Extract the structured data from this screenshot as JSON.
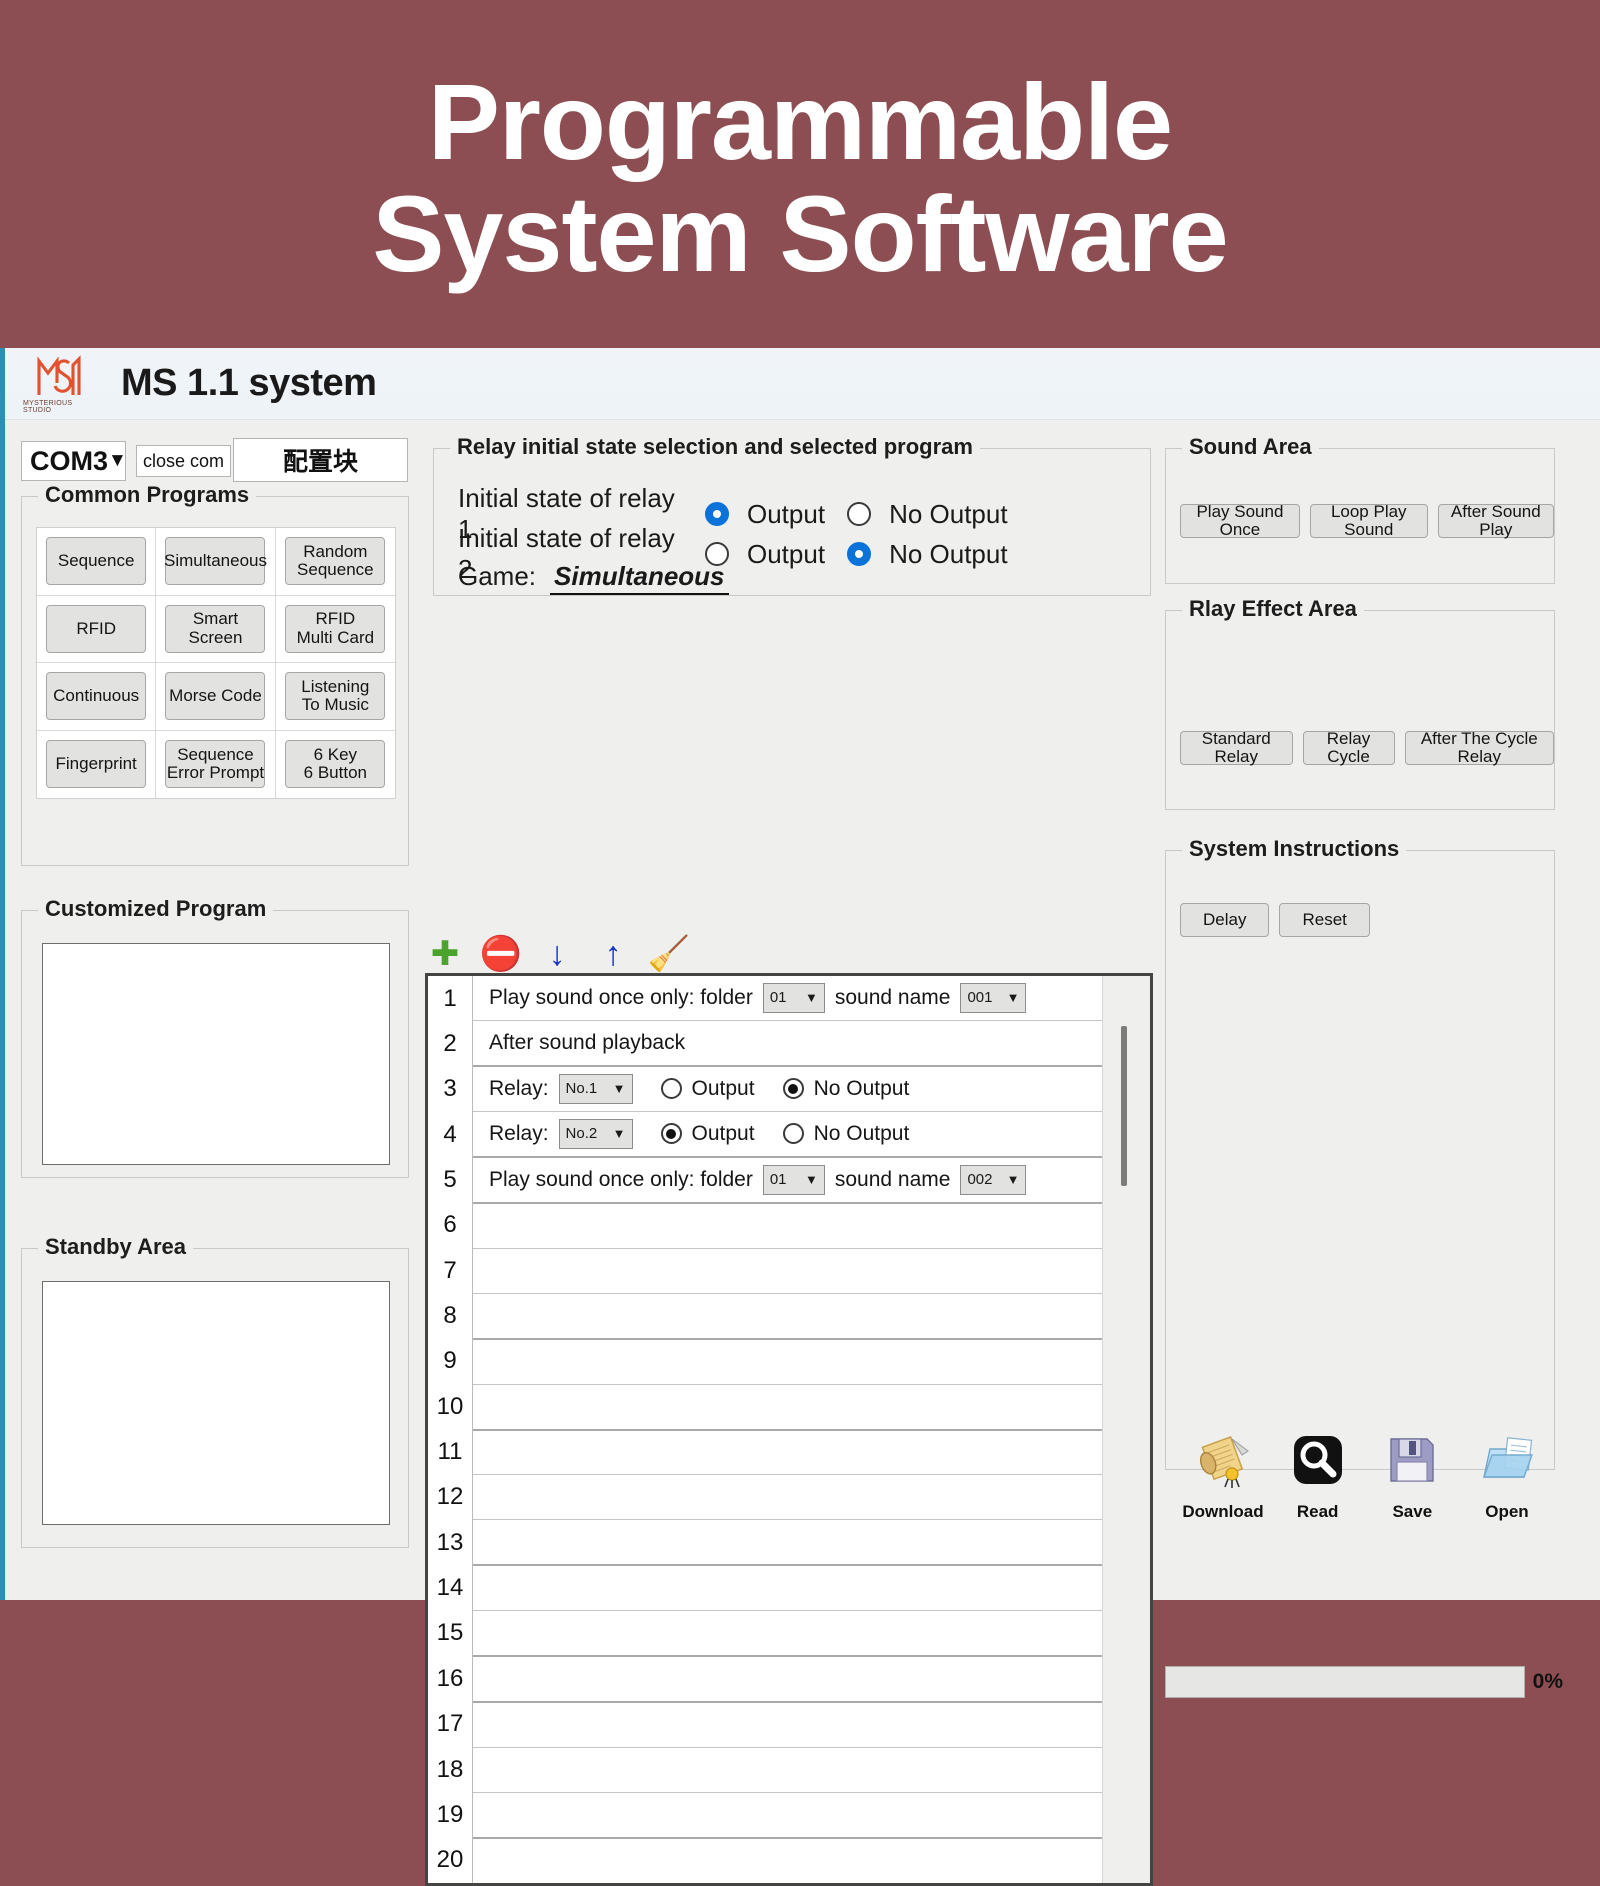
{
  "banner": {
    "line1": "Programmable",
    "line2": "System Software",
    "bg_color": "#8d4e53",
    "text_color": "#ffffff"
  },
  "titlebar": {
    "app_title": "MS 1.1 system",
    "logo_subtitle": "MYSTERIOUS STUDIO",
    "logo_color": "#e2522e"
  },
  "left": {
    "com_port": {
      "value": "COM3",
      "arrow": "▼"
    },
    "close_com_label": "close com",
    "config_block_label": "配置块",
    "common_programs": {
      "legend": "Common Programs",
      "buttons": [
        "Sequence",
        "Simultaneous",
        "Random\nSequence",
        "RFID",
        "Smart\nScreen",
        "RFID\nMulti Card",
        "Continuous",
        "Morse Code",
        "Listening\nTo Music",
        "Fingerprint",
        "Sequence\nError Prompt",
        "6 Key\n6 Button"
      ]
    },
    "customized_program": {
      "legend": "Customized Program",
      "content": ""
    },
    "standby_area": {
      "legend": "Standby Area",
      "content": ""
    }
  },
  "center": {
    "relay_init": {
      "legend": "Relay initial state selection and selected program",
      "relay1": {
        "label": "Initial state of relay 1",
        "output_label": "Output",
        "no_output_label": "No Output",
        "selected": "Output"
      },
      "relay2": {
        "label": "Initial state of relay 2",
        "output_label": "Output",
        "no_output_label": "No Output",
        "selected": "No Output"
      },
      "game_label": "Game:",
      "game_value": "Simultaneous"
    },
    "toolbar": [
      {
        "name": "add-icon",
        "glyph": "✚",
        "color": "#4aa32d"
      },
      {
        "name": "remove-icon",
        "glyph": "⛔",
        "color": "#cc2222"
      },
      {
        "name": "move-down-icon",
        "glyph": "↓",
        "color": "#1634c8"
      },
      {
        "name": "move-up-icon",
        "glyph": "↑",
        "color": "#1634c8"
      },
      {
        "name": "clear-broom-icon",
        "glyph": "🧹",
        "color": "#c9a44c"
      }
    ],
    "row_numbers": [
      "1",
      "2",
      "3",
      "4",
      "5",
      "6",
      "7",
      "8",
      "9",
      "10",
      "11",
      "12",
      "13",
      "14",
      "15",
      "16",
      "17",
      "18",
      "19",
      "20"
    ],
    "rows": [
      {
        "index": 1,
        "type": "play-sound-once",
        "text_before": "Play sound once only: folder",
        "folder_value": "01",
        "text_middle": "sound name",
        "sound_value": "001"
      },
      {
        "index": 2,
        "type": "text",
        "text_before": "After sound playback"
      },
      {
        "index": 3,
        "type": "relay",
        "text_before": "Relay:",
        "relay_value": "No.1",
        "output_label": "Output",
        "no_output_label": "No Output",
        "selected": "No Output"
      },
      {
        "index": 4,
        "type": "relay",
        "text_before": "Relay:",
        "relay_value": "No.2",
        "output_label": "Output",
        "no_output_label": "No Output",
        "selected": "Output"
      },
      {
        "index": 5,
        "type": "play-sound-once",
        "text_before": "Play sound once only: folder",
        "folder_value": "01",
        "text_middle": "sound name",
        "sound_value": "002"
      },
      {
        "index": 6,
        "type": "empty"
      },
      {
        "index": 7,
        "type": "empty"
      },
      {
        "index": 8,
        "type": "empty"
      },
      {
        "index": 9,
        "type": "empty"
      },
      {
        "index": 10,
        "type": "empty"
      },
      {
        "index": 11,
        "type": "empty"
      },
      {
        "index": 12,
        "type": "empty"
      },
      {
        "index": 13,
        "type": "empty"
      },
      {
        "index": 14,
        "type": "empty"
      },
      {
        "index": 15,
        "type": "empty"
      },
      {
        "index": 16,
        "type": "empty"
      },
      {
        "index": 17,
        "type": "empty"
      },
      {
        "index": 18,
        "type": "empty"
      },
      {
        "index": 19,
        "type": "empty"
      },
      {
        "index": 20,
        "type": "empty"
      }
    ]
  },
  "right": {
    "sound_area": {
      "legend": "Sound Area",
      "buttons": [
        "Play Sound Once",
        "Loop Play Sound",
        "After Sound Play"
      ]
    },
    "relay_effect_area": {
      "legend": "Rlay Effect Area",
      "buttons": [
        "Standard Relay",
        "Relay Cycle",
        "After The Cycle Relay"
      ]
    },
    "system_instructions": {
      "legend": "System Instructions",
      "buttons": [
        "Delay",
        "Reset"
      ]
    },
    "actions": [
      {
        "icon": "download-scroll-icon",
        "label": "Download"
      },
      {
        "icon": "read-magnifier-icon",
        "label": "Read"
      },
      {
        "icon": "save-floppy-icon",
        "label": "Save"
      },
      {
        "icon": "open-folder-icon",
        "label": "Open"
      }
    ],
    "progress": {
      "value": 0,
      "label": "0%"
    }
  }
}
